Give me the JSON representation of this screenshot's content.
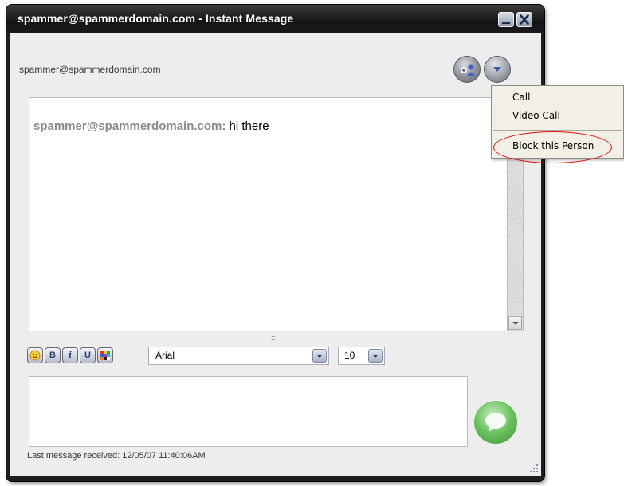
{
  "window": {
    "title": "spammer@spammerdomain.com - Instant Message",
    "minimize_icon": "minimize-icon",
    "close_icon": "close-icon"
  },
  "header": {
    "contact_email": "spammer@spammerdomain.com",
    "contacts_button_icon": "add-contact-icon",
    "menu_button_icon": "chevron-down-icon"
  },
  "conversation": {
    "messages": [
      {
        "sender": "spammer@spammerdomain.com:",
        "text": " hi there"
      }
    ]
  },
  "toolbar": {
    "emoji_icon": "smiley-icon",
    "bold_label": "B",
    "italic_label": "i",
    "underline_label": "U",
    "color_icon": "color-palette-icon",
    "font_value": "Arial",
    "size_value": "10"
  },
  "composer": {
    "value": "",
    "send_icon": "speech-bubble-icon"
  },
  "status": {
    "text": "Last message received: 12/05/07 11:40:06AM"
  },
  "context_menu": {
    "items": [
      {
        "label": "Call"
      },
      {
        "label": "Video Call"
      },
      {
        "label": "Block this Person"
      }
    ]
  },
  "colors": {
    "title_bar": "#1a1a1a",
    "client_bg": "#ededed",
    "sender_gray": "#8a8a8a",
    "highlight_red": "#e01010",
    "send_green": "#69c15d"
  }
}
